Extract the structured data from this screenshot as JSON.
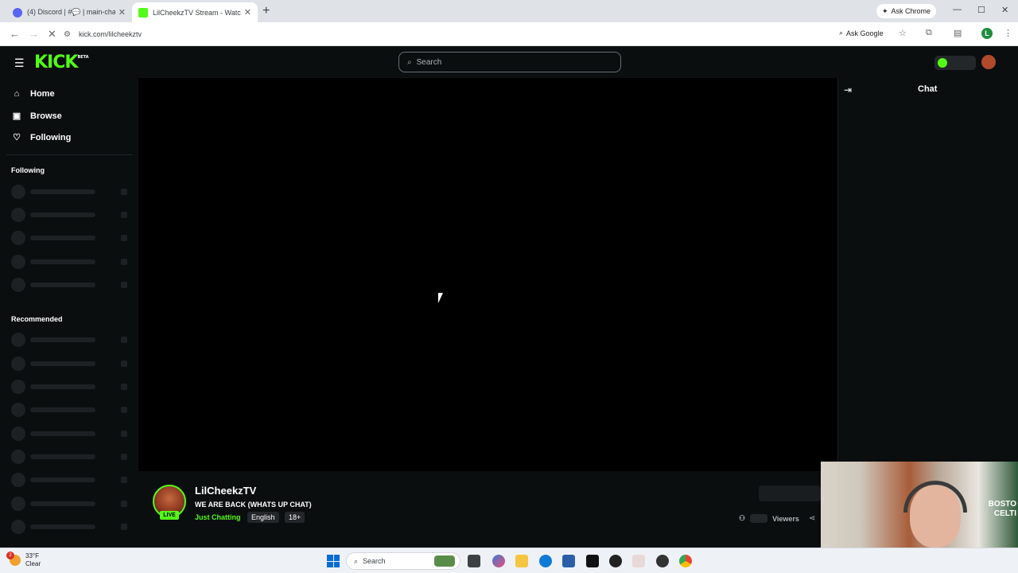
{
  "browser": {
    "tabs": [
      {
        "title": "(4) Discord | #💬 | main-chat | ...",
        "active": false
      },
      {
        "title": "LilCheekzTV Stream - Watch Li...",
        "active": true
      }
    ],
    "ask_chrome": "Ask Chrome",
    "url": "kick.com/lilcheekztv",
    "ask_google": "Ask Google",
    "profile_initial": "L"
  },
  "kick": {
    "logo": "KICK",
    "logo_badge": "BETA",
    "search_placeholder": "Search"
  },
  "sidebar": {
    "nav": [
      {
        "label": "Home",
        "icon": "home-icon"
      },
      {
        "label": "Browse",
        "icon": "browse-icon"
      },
      {
        "label": "Following",
        "icon": "heart-icon"
      }
    ],
    "following_title": "Following",
    "recommended_title": "Recommended"
  },
  "stream": {
    "channel": "LilCheekzTV",
    "title": "WE ARE BACK (WHATS UP CHAT)",
    "category": "Just Chatting",
    "tags": [
      "English",
      "18+"
    ],
    "live_label": "LIVE",
    "viewers_label": "Viewers"
  },
  "chat": {
    "title": "Chat"
  },
  "webcam": {
    "banner_text_1": "BOSTO",
    "banner_text_2": "CELTI"
  },
  "taskbar": {
    "temp": "33°F",
    "weather": "Clear",
    "notification_count": "2",
    "search_placeholder": "Search"
  },
  "colors": {
    "kick_green": "#53fc18",
    "bg": "#0b0e0f"
  }
}
